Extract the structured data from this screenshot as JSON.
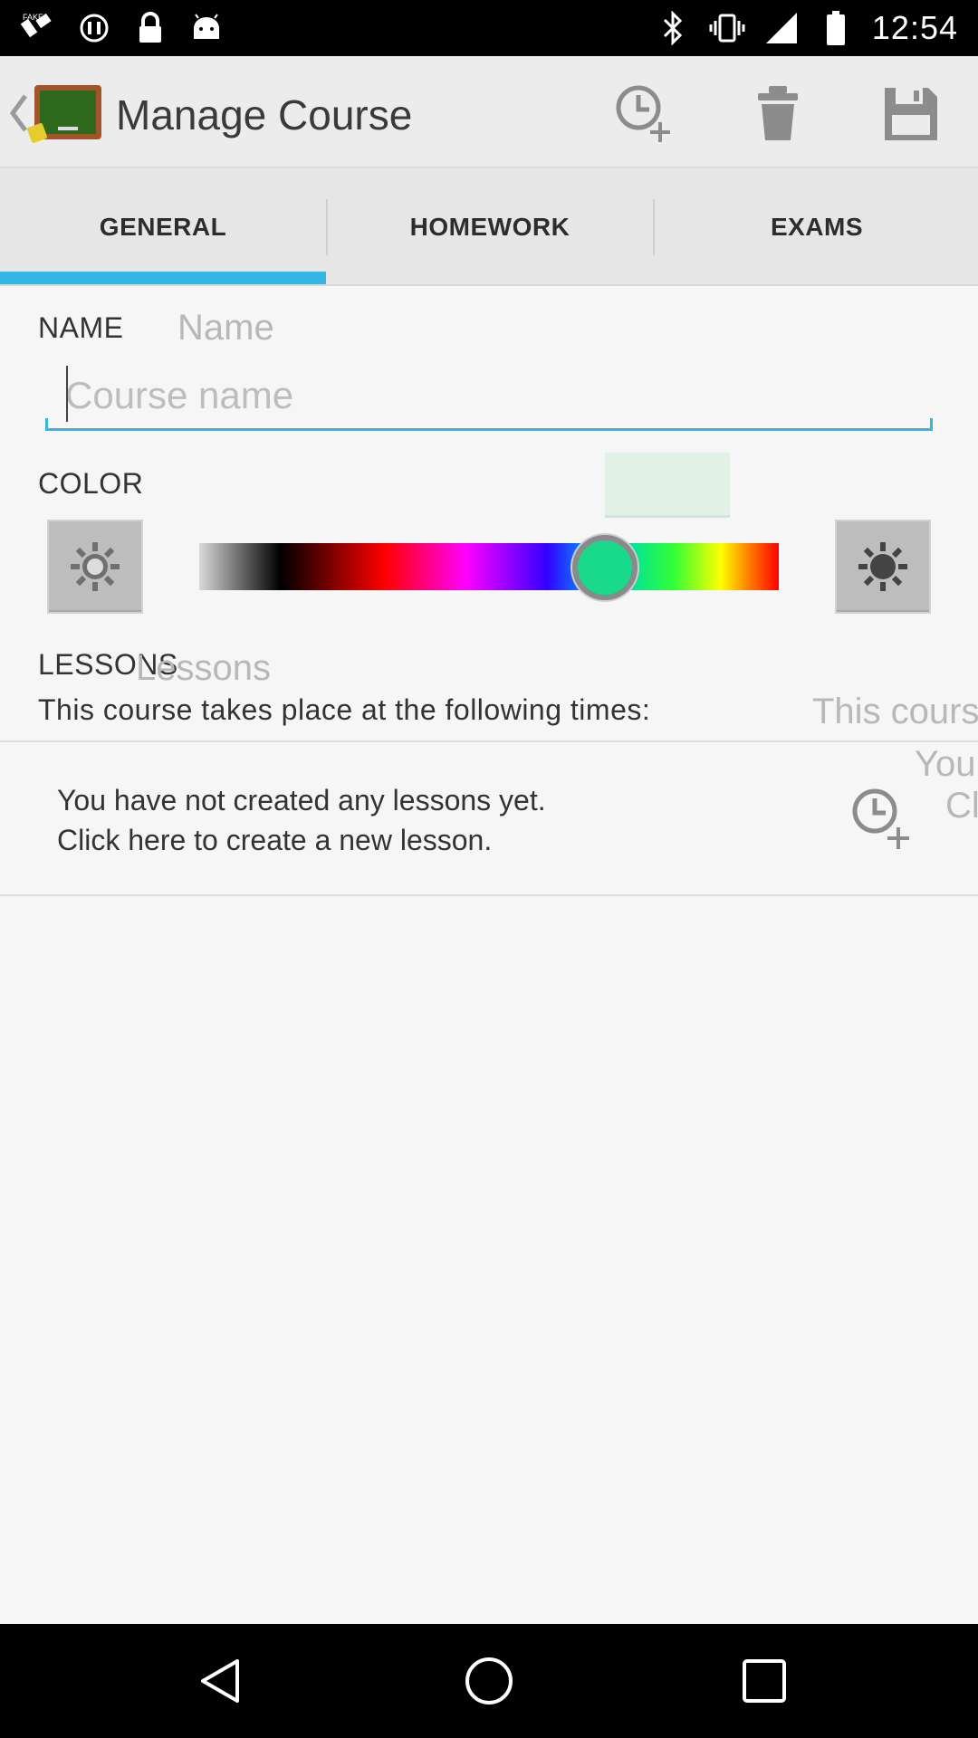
{
  "status_bar": {
    "time": "12:54",
    "left_icons": [
      "fake-gps-icon",
      "no-signal-circle-icon",
      "lock-icon",
      "android-icon"
    ],
    "right_icons": [
      "bluetooth-icon",
      "vibrate-icon",
      "signal-icon",
      "battery-icon"
    ]
  },
  "action_bar": {
    "title": "Manage Course",
    "actions": [
      "add-lesson-time-icon",
      "delete-icon",
      "save-icon"
    ]
  },
  "tabs": [
    {
      "label": "GENERAL",
      "selected": true
    },
    {
      "label": "HOMEWORK",
      "selected": false
    },
    {
      "label": "EXAMS",
      "selected": false
    }
  ],
  "general": {
    "name_label": "NAME",
    "name_ghost": "Name",
    "name_placeholder": "Course name",
    "name_value": "",
    "color_label": "COLOR",
    "selected_color": "#e2f1e6",
    "spectrum_position": 0.7,
    "lessons_label": "LESSONS",
    "lessons_ghost": "Lessons",
    "lessons_description": "This course takes place at the following times:",
    "lessons_description_ghost": "This cours",
    "empty_line1": "You have not created any lessons yet.",
    "empty_line2": "Click here to create a new lesson.",
    "empty_ghost_line1": "You",
    "empty_ghost_line2": "Clic"
  },
  "colors": {
    "accent": "#33b5e5",
    "action_bar_bg": "#ececec",
    "tab_bg": "#e6e6e6"
  },
  "nav_bar": [
    "back-icon",
    "home-icon",
    "recents-icon"
  ]
}
